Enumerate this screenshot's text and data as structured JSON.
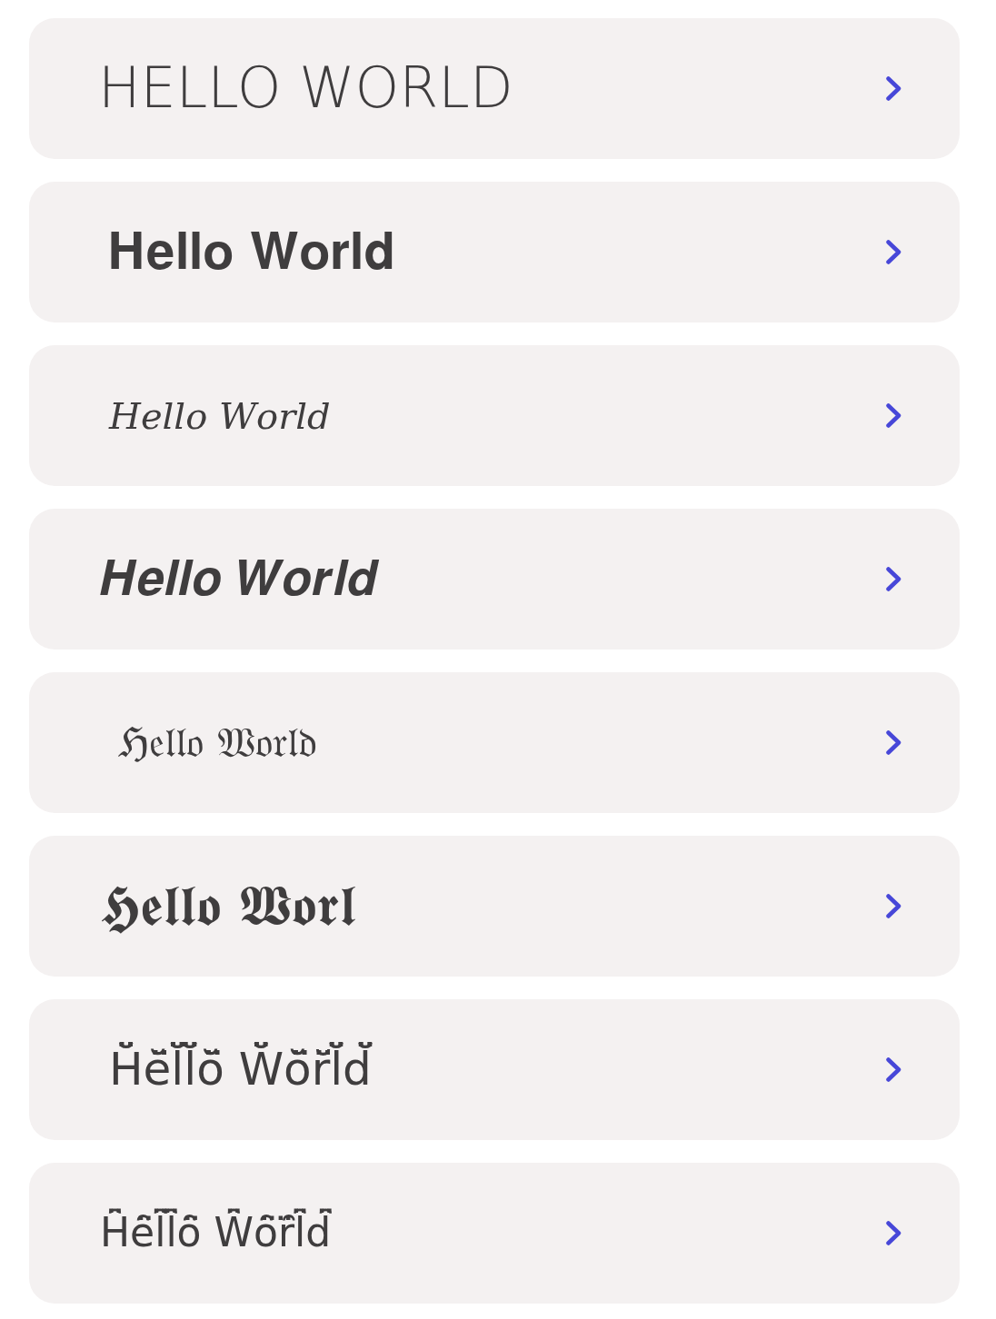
{
  "font_styles": [
    {
      "kind": "rounded-caps",
      "text": "HELLO WORLD"
    },
    {
      "kind": "bold-serif",
      "text": "𝐇𝐞𝐥𝐥𝐨 𝐖𝐨𝐫𝐥𝐝"
    },
    {
      "kind": "italic-serif",
      "text": "𝐻𝑒𝑙𝑙𝑜 𝑊𝑜𝑟𝑙𝑑"
    },
    {
      "kind": "bold-italic-serif",
      "text": "𝑯𝒆𝒍𝒍𝒐 𝑾𝒐𝒓𝒍𝒅"
    },
    {
      "kind": "fraktur",
      "text": "ℌ𝔢𝔩𝔩𝔬 𝔚𝔬𝔯𝔩𝔡"
    },
    {
      "kind": "bold-fraktur",
      "text": "𝕳𝖊𝖑𝖑𝖔 𝖂𝖔𝖗𝖑"
    },
    {
      "kind": "smile-marks",
      "text": "H̆̈ĕ̈l̆̈l̆̈ŏ̈ W̆̈ŏ̈r̆̈l̆̈d̆̈"
    },
    {
      "kind": "frown-marks",
      "text": "H̑̈ȇ̈l̑̈l̑̈ȏ̈ W̑̈ȏ̈ȓ̈l̑̈d̑̈"
    }
  ]
}
